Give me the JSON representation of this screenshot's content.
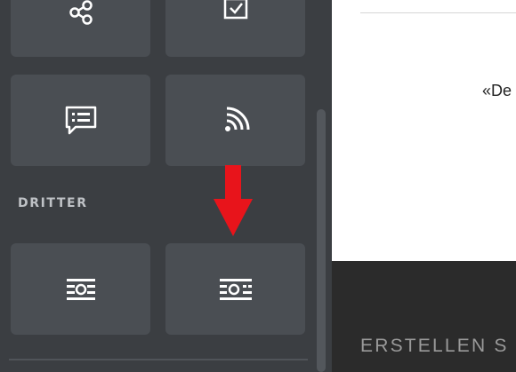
{
  "sidebar": {
    "tiles_top": [
      {
        "icon": "share-icon"
      },
      {
        "icon": "checkbox-icon"
      }
    ],
    "tiles_middle": [
      {
        "icon": "comment-list-icon"
      },
      {
        "icon": "rss-feed-icon"
      }
    ],
    "section_label": "DRITTER",
    "tiles_third_party": [
      {
        "icon": "embed-content-icon"
      },
      {
        "icon": "embed-content-alt-icon"
      }
    ]
  },
  "preview": {
    "text": "«De"
  },
  "footer": {
    "text": "ERSTELLEN S"
  },
  "annotation": {
    "arrow_color": "#e8141b",
    "icon": "red-down-arrow-icon"
  },
  "colors": {
    "sidebar_bg": "#3b3e42",
    "tile_bg": "#4a4e53",
    "footer_bg": "#2b2b2b"
  }
}
